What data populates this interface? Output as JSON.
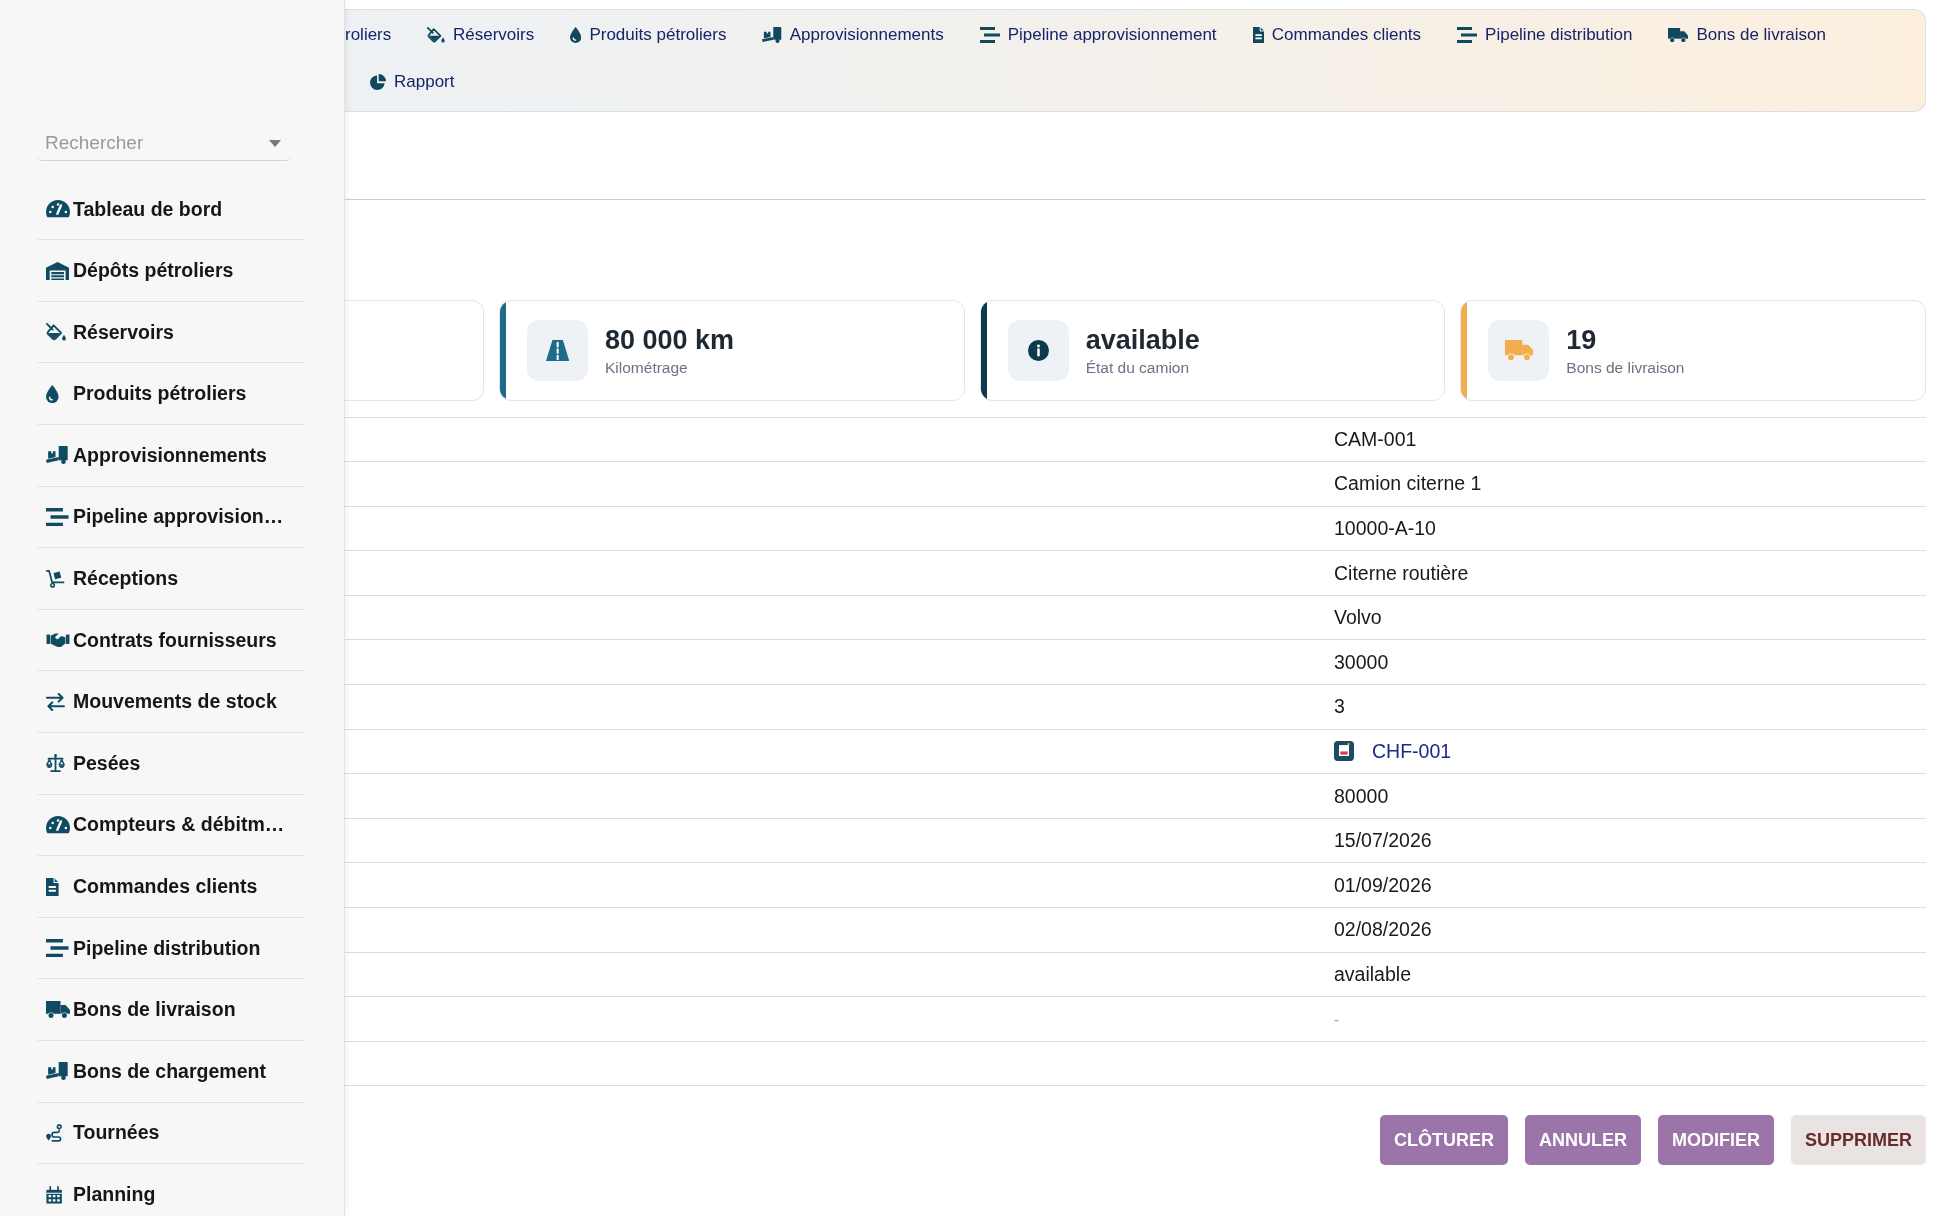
{
  "sidebar": {
    "search": {
      "placeholder": "Rechercher"
    },
    "items": [
      {
        "label": "Tableau de bord"
      },
      {
        "label": "Dépôts pétroliers"
      },
      {
        "label": "Réservoirs"
      },
      {
        "label": "Produits pétroliers"
      },
      {
        "label": "Approvisionnements"
      },
      {
        "label": "Pipeline approvision…"
      },
      {
        "label": "Réceptions"
      },
      {
        "label": "Contrats fournisseurs"
      },
      {
        "label": "Mouvements de stock"
      },
      {
        "label": "Pesées"
      },
      {
        "label": "Compteurs & débitm…"
      },
      {
        "label": "Commandes clients"
      },
      {
        "label": "Pipeline distribution"
      },
      {
        "label": "Bons de livraison"
      },
      {
        "label": "Bons de chargement"
      },
      {
        "label": "Tournées"
      },
      {
        "label": "Planning"
      }
    ]
  },
  "top_nav": {
    "items": [
      {
        "label": "roliers",
        "kind": "cut"
      },
      {
        "label": "Réservoirs",
        "kind": "link"
      },
      {
        "label": "Produits pétroliers",
        "kind": "link"
      },
      {
        "label": "Approvisionnements",
        "kind": "link"
      },
      {
        "label": "Pipeline approvisionnement",
        "kind": "link"
      },
      {
        "label": "Commandes clients",
        "kind": "link"
      },
      {
        "label": "Pipeline distribution",
        "kind": "link"
      },
      {
        "label": "Bons de livraison",
        "kind": "link"
      },
      {
        "label": "Rapport",
        "kind": "link"
      }
    ]
  },
  "stat_cards": [
    {
      "value": "80 000 km",
      "label": "Kilométrage",
      "color": "#1e6b89"
    },
    {
      "value": "available",
      "label": "État du camion",
      "color": "#0e3a4d"
    },
    {
      "value": "19",
      "label": "Bons de livraison",
      "color": "#f2ad4e"
    }
  ],
  "details": {
    "rows": [
      {
        "kind": "text",
        "value": "CAM-001"
      },
      {
        "kind": "text",
        "value": "Camion citerne 1"
      },
      {
        "kind": "text",
        "value": "10000-A-10"
      },
      {
        "kind": "text",
        "value": "Citerne routière"
      },
      {
        "kind": "text",
        "value": "Volvo"
      },
      {
        "kind": "text",
        "value": "30000"
      },
      {
        "kind": "text",
        "value": "3"
      },
      {
        "kind": "link",
        "value": "CHF-001"
      },
      {
        "kind": "text",
        "value": "80000"
      },
      {
        "kind": "text",
        "value": "15/07/2026"
      },
      {
        "kind": "text",
        "value": "01/09/2026"
      },
      {
        "kind": "text",
        "value": "02/08/2026"
      },
      {
        "kind": "text",
        "value": "available"
      },
      {
        "kind": "muted",
        "value": "-"
      },
      {
        "kind": "blank"
      }
    ]
  },
  "actions": [
    {
      "label": "CLÔTURER",
      "kind": "primary"
    },
    {
      "label": "ANNULER",
      "kind": "primary"
    },
    {
      "label": "MODIFIER",
      "kind": "primary"
    },
    {
      "label": "SUPPRIMER",
      "kind": "danger"
    }
  ]
}
